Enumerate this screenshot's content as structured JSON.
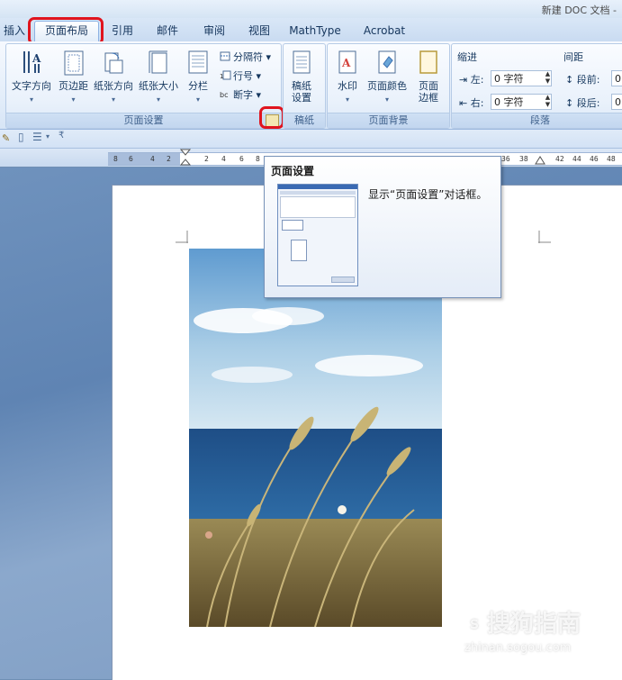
{
  "window": {
    "title": "新建 DOC 文档 -"
  },
  "tabs": [
    {
      "label": "插入"
    },
    {
      "label": "页面布局",
      "active": true
    },
    {
      "label": "引用"
    },
    {
      "label": "邮件"
    },
    {
      "label": "审阅"
    },
    {
      "label": "视图"
    },
    {
      "label": "MathType"
    },
    {
      "label": "Acrobat"
    }
  ],
  "ribbon": {
    "page_setup": {
      "group_label": "页面设置",
      "text_direction": "文字方向",
      "margins": "页边距",
      "orientation": "纸张方向",
      "size": "纸张大小",
      "columns": "分栏",
      "breaks": "分隔符",
      "line_numbers": "行号",
      "hyphenation": "断字"
    },
    "draft": {
      "group_label": "稿纸",
      "button_line1": "稿纸",
      "button_line2": "设置"
    },
    "page_background": {
      "group_label": "页面背景",
      "watermark": "水印",
      "page_color": "页面颜色",
      "borders_line1": "页面",
      "borders_line2": "边框"
    },
    "paragraph": {
      "group_label": "段落",
      "indent_title": "缩进",
      "spacing_title": "间距",
      "indent_left_label": "左:",
      "indent_left_value": "0 字符",
      "indent_right_label": "右:",
      "indent_right_value": "0 字符",
      "space_before_label": "段前:",
      "space_before_value": "0",
      "space_after_label": "段后:",
      "space_after_value": "0"
    }
  },
  "ruler": {
    "left_numbers": [
      "8",
      "6",
      "4",
      "2",
      "2",
      "4",
      "6",
      "8"
    ],
    "right_numbers": [
      "36",
      "38",
      "42",
      "44",
      "46",
      "48"
    ]
  },
  "tooltip": {
    "title": "页面设置",
    "description": "显示“页面设置”对话框。"
  },
  "watermark": {
    "brand": "搜狗指南",
    "url": "zhinan.sogou.com"
  },
  "colors": {
    "highlight": "#e0141e",
    "ribbon_text": "#15375e"
  }
}
